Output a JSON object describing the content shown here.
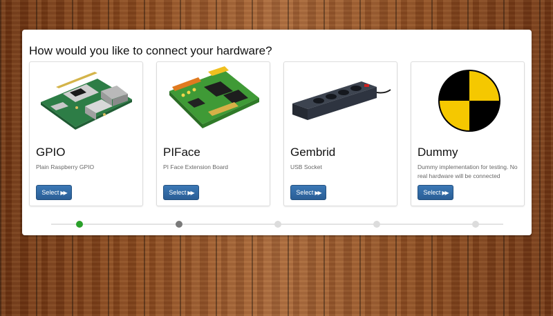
{
  "page": {
    "title": "How would you like to connect your hardware?"
  },
  "cards": [
    {
      "name": "GPIO",
      "description": "Plain Raspberry GPIO",
      "button": "Select",
      "icon": "raspberry-pi-board-icon"
    },
    {
      "name": "PIFace",
      "description": "PI Face Extension Board",
      "button": "Select",
      "icon": "piface-board-icon"
    },
    {
      "name": "Gembrid",
      "description": "USB Socket",
      "button": "Select",
      "icon": "power-strip-icon"
    },
    {
      "name": "Dummy",
      "description": "Dummy implementation for testing. No real hardware will be connected",
      "button": "Select",
      "icon": "test-target-icon"
    }
  ],
  "stepper": {
    "steps": 5,
    "current": 1,
    "completed": [
      1
    ],
    "active": [
      2
    ]
  },
  "colors": {
    "button": "#2a5e96",
    "step_done": "#2aa02a",
    "step_active": "#7a7a7a",
    "step_pending": "#dcdcdc",
    "dummy_yellow": "#f5c800"
  }
}
